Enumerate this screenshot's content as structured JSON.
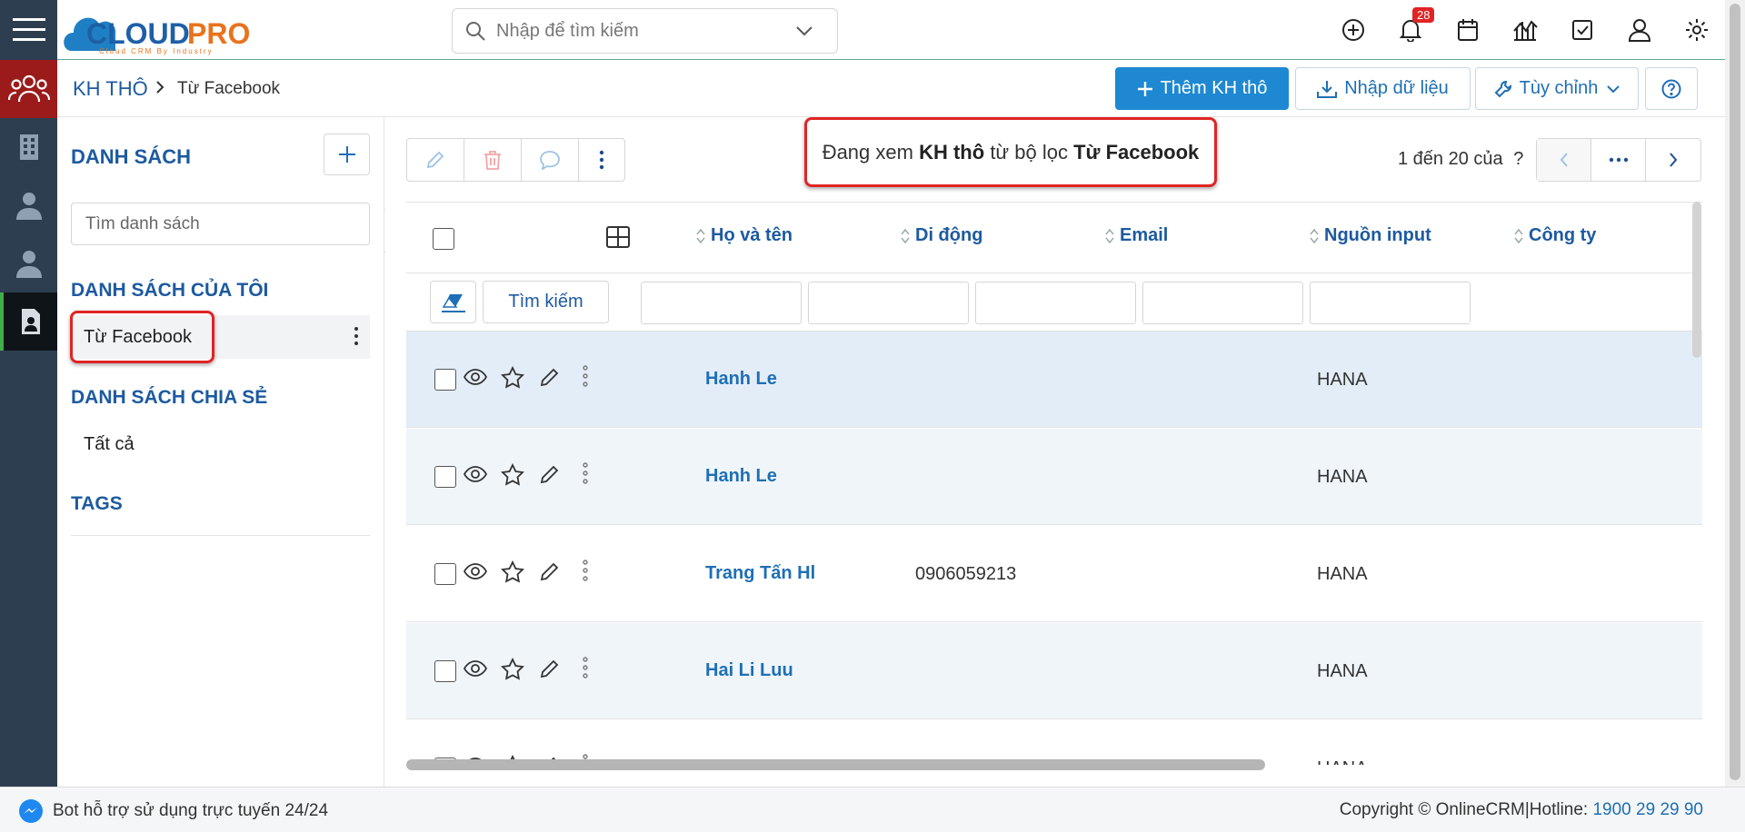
{
  "header": {
    "logo_text": "CLOUDPRO",
    "logo_tagline": "Cloud CRM By Industry",
    "search_placeholder": "Nhập để tìm kiếm",
    "notification_count": "28"
  },
  "breadcrumb": {
    "root": "KH THÔ",
    "current": "Từ Facebook"
  },
  "actions": {
    "add_label": "Thêm KH thô",
    "import_label": "Nhập dữ liệu",
    "customize_label": "Tùy chỉnh"
  },
  "sidebar_panel": {
    "title": "DANH SÁCH",
    "search_placeholder": "Tìm danh sách",
    "my_lists_title": "DANH SÁCH CỦA TÔI",
    "my_lists": [
      "Từ Facebook"
    ],
    "shared_title": "DANH SÁCH CHIA SẺ",
    "shared_lists": [
      "Tất cả"
    ],
    "tags_title": "TAGS"
  },
  "viewing": {
    "prefix": "Đang xem",
    "module": "KH thô",
    "middle": "từ bộ lọc",
    "filter": "Từ Facebook"
  },
  "pager": {
    "text": "1 đến 20 của",
    "unknown": "?"
  },
  "table": {
    "columns": [
      "Họ và tên",
      "Di động",
      "Email",
      "Nguồn input",
      "Công ty"
    ],
    "search_button": "Tìm kiếm",
    "rows": [
      {
        "name": "Hanh Le",
        "phone": "",
        "email": "",
        "source": "HANA",
        "company": ""
      },
      {
        "name": "Hanh Le",
        "phone": "",
        "email": "",
        "source": "HANA",
        "company": ""
      },
      {
        "name": "Trang Tấn Hl",
        "phone": "0906059213",
        "email": "",
        "source": "HANA",
        "company": ""
      },
      {
        "name": "Hai Li Luu",
        "phone": "",
        "email": "",
        "source": "HANA",
        "company": ""
      },
      {
        "name": "",
        "phone": "",
        "email": "",
        "source": "HANA",
        "company": ""
      }
    ]
  },
  "footer": {
    "bot_text": "Bot hỗ trợ sử dụng trực tuyến 24/24",
    "copyright": "Copyright © OnlineCRM",
    "hotline_label": "Hotline:",
    "hotline": "1900 29 29 90"
  },
  "colors": {
    "brand_blue": "#1e88d2",
    "heading_blue": "#1d5aa0",
    "sidebar_dark": "#2d3e50",
    "rail_red": "#9b1b1b",
    "highlight_red": "#e02424"
  }
}
